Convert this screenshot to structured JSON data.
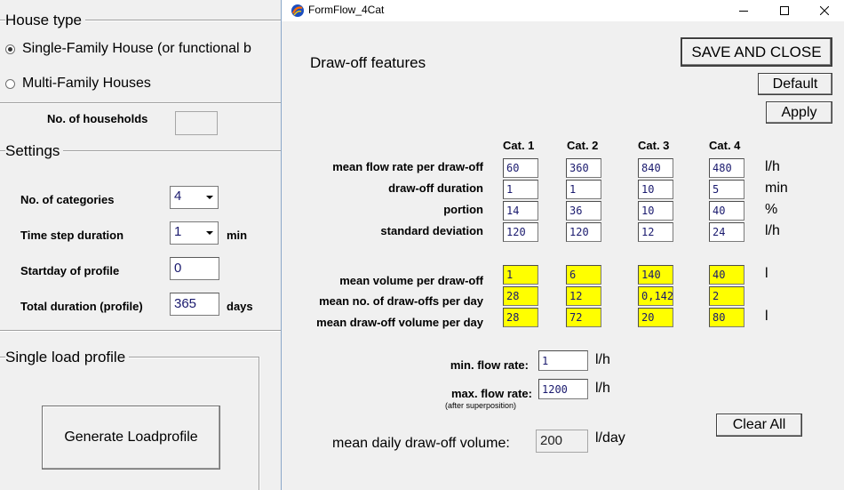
{
  "left": {
    "house_type_title": "House type",
    "radio_single": "Single-Family House (or functional b",
    "radio_multi": "Multi-Family Houses",
    "households_label": "No. of households",
    "households_value": "",
    "settings_title": "Settings",
    "categories_label": "No. of categories",
    "categories_value": "4",
    "timestep_label": "Time step duration",
    "timestep_value": "1",
    "timestep_unit": "min",
    "startday_label": "Startday of profile",
    "startday_value": "0",
    "total_label": "Total duration (profile)",
    "total_value": "365",
    "total_unit": "days",
    "single_load_title": "Single load profile",
    "generate_button": "Generate Loadprofile"
  },
  "dialog": {
    "title": "FormFlow_4Cat",
    "section_title": "Draw-off features",
    "save_close": "SAVE AND CLOSE",
    "default_button": "Default",
    "apply_button": "Apply",
    "categories": [
      "Cat. 1",
      "Cat. 2",
      "Cat. 3",
      "Cat. 4"
    ],
    "rows": [
      {
        "label": "mean flow rate per draw-off",
        "values": [
          "60",
          "360",
          "840",
          "480"
        ],
        "unit": "l/h"
      },
      {
        "label": "draw-off duration",
        "values": [
          "1",
          "1",
          "10",
          "5"
        ],
        "unit": "min"
      },
      {
        "label": "portion",
        "values": [
          "14",
          "36",
          "10",
          "40"
        ],
        "unit": "%"
      },
      {
        "label": "standard deviation",
        "values": [
          "120",
          "120",
          "12",
          "24"
        ],
        "unit": "l/h"
      }
    ],
    "computed_rows": [
      {
        "label": "mean volume per draw-off",
        "values": [
          "1",
          "6",
          "140",
          "40"
        ],
        "unit": "l"
      },
      {
        "label": "mean no. of draw-offs per day",
        "values": [
          "28",
          "12",
          "0,142",
          "2"
        ],
        "unit": ""
      },
      {
        "label": "mean draw-off volume per day",
        "values": [
          "28",
          "72",
          "20",
          "80"
        ],
        "unit": "l"
      }
    ],
    "min_flow_label": "min. flow rate:",
    "min_flow_value": "1",
    "min_flow_unit": "l/h",
    "max_flow_label": "max. flow rate:",
    "max_flow_value": "1200",
    "max_flow_unit": "l/h",
    "max_flow_note": "(after superposition)",
    "clear_all": "Clear All",
    "daily_label": "mean daily draw-off volume:",
    "daily_value": "200",
    "daily_unit": "l/day"
  }
}
